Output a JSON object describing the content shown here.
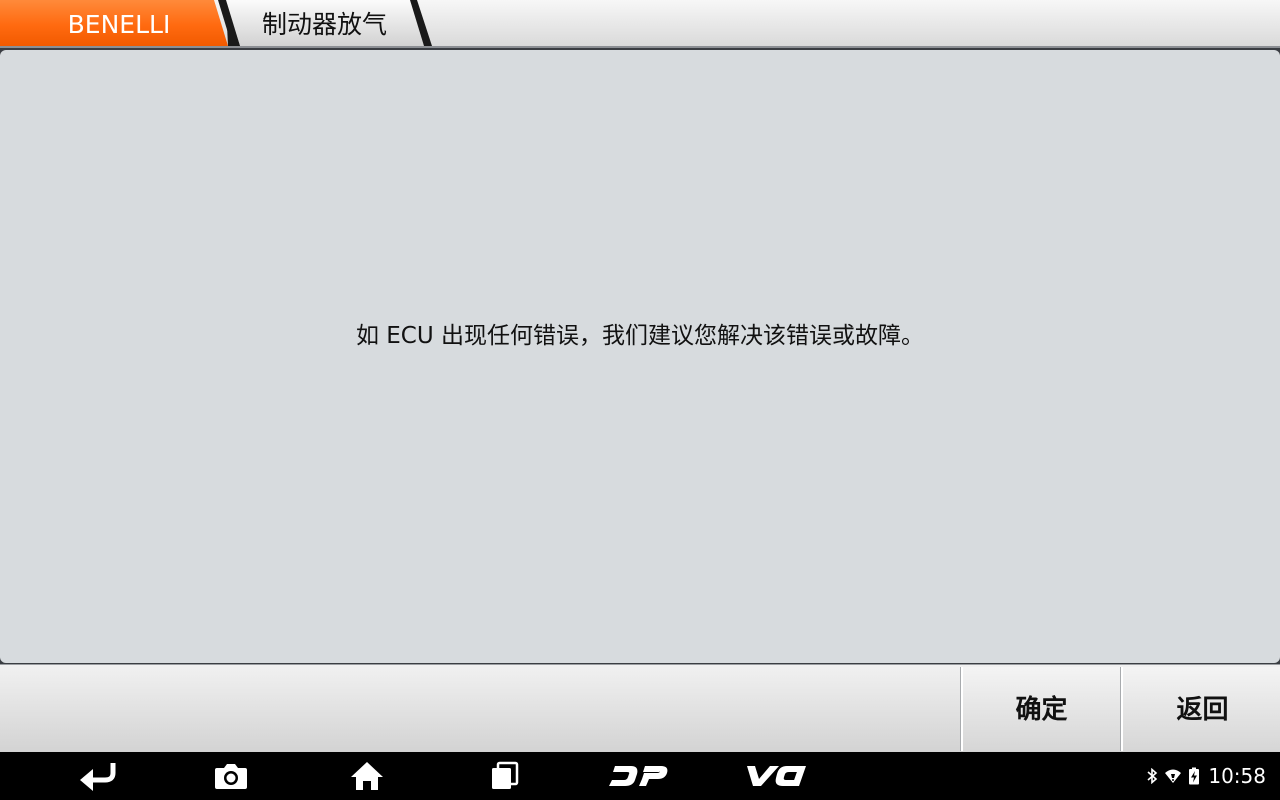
{
  "breadcrumb": {
    "items": [
      {
        "label": "BENELLI",
        "color": "#ff6a10"
      },
      {
        "label": "制动器放气"
      }
    ]
  },
  "panel": {
    "message": "如 ECU 出现任何错误，我们建议您解决该错误或故障。"
  },
  "actions": {
    "confirm_label": "确定",
    "back_label": "返回"
  },
  "navbar": {
    "buttons": [
      {
        "icon": "back-arrow-icon"
      },
      {
        "icon": "camera-icon"
      },
      {
        "icon": "home-icon"
      },
      {
        "icon": "recent-apps-icon"
      },
      {
        "icon": "dp-logo-icon",
        "label": "DP"
      },
      {
        "icon": "vci-logo-icon",
        "label": "VCI"
      }
    ],
    "status": {
      "icons": [
        "bluetooth-icon",
        "wifi-icon",
        "battery-icon"
      ],
      "time": "10:58"
    }
  }
}
